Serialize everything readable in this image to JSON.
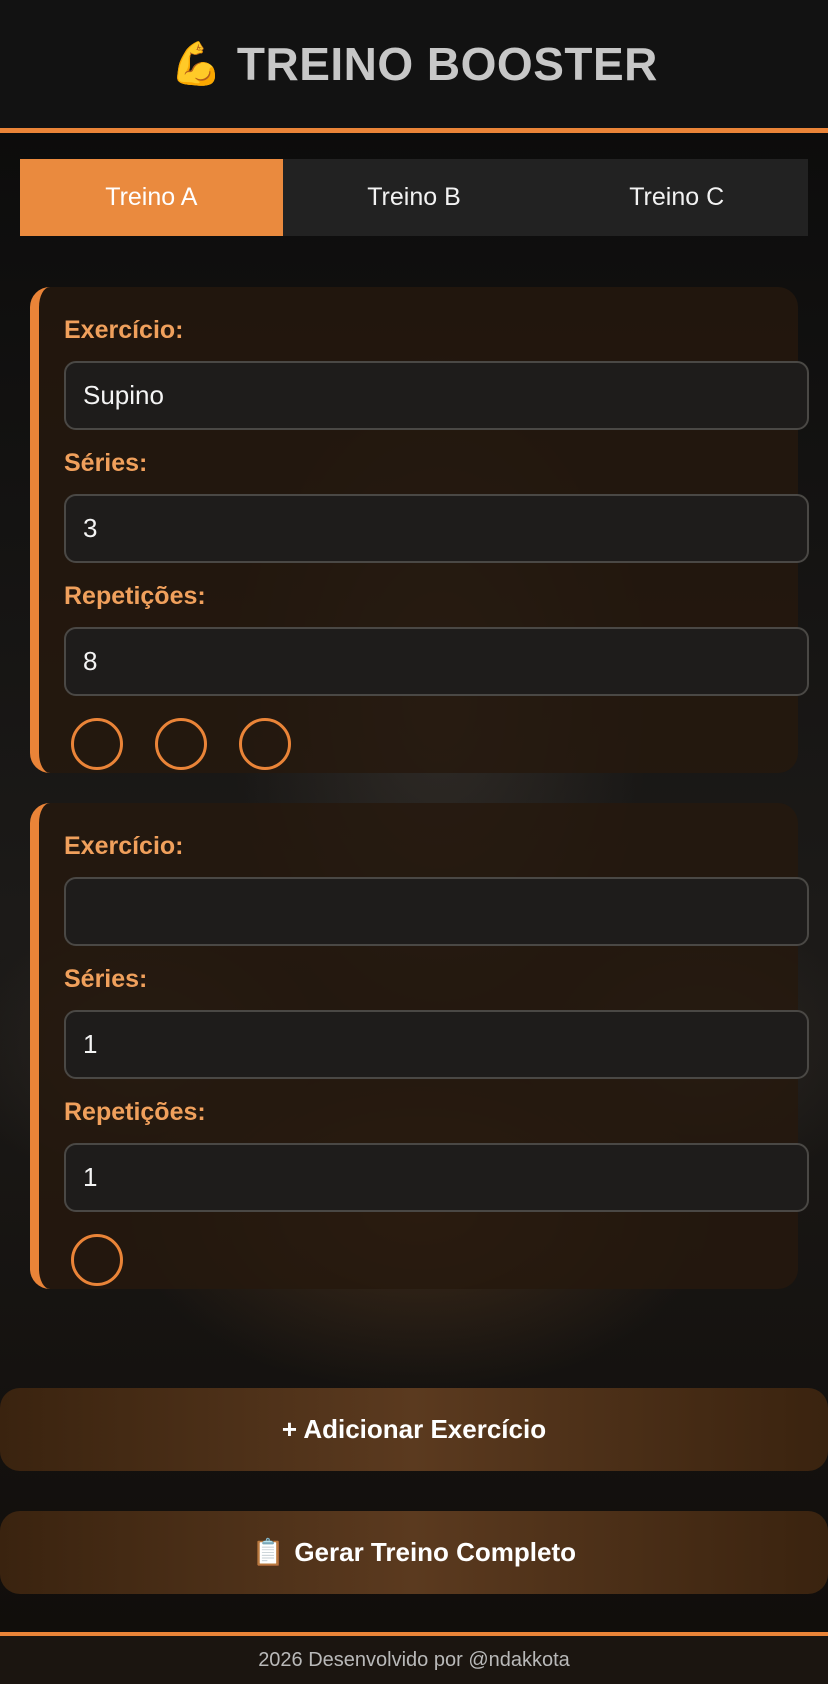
{
  "header": {
    "icon": "💪",
    "icon_name": "flexed-biceps-icon",
    "title": "TREINO BOOSTER"
  },
  "tabs": [
    {
      "label": "Treino A",
      "active": true
    },
    {
      "label": "Treino B",
      "active": false
    },
    {
      "label": "Treino C",
      "active": false
    }
  ],
  "exercises": [
    {
      "exercise_label": "Exercício:",
      "exercise_value": "Supino",
      "sets_label": "Séries:",
      "sets_value": "3",
      "reps_label": "Repetições:",
      "reps_value": "8",
      "set_circles": 3
    },
    {
      "exercise_label": "Exercício:",
      "exercise_value": "",
      "sets_label": "Séries:",
      "sets_value": "1",
      "reps_label": "Repetições:",
      "reps_value": "1",
      "set_circles": 1
    }
  ],
  "buttons": {
    "add_label": "+ Adicionar Exercício",
    "generate_icon": "📋",
    "generate_icon_name": "clipboard-icon",
    "generate_label": "Gerar Treino Completo"
  },
  "footer": {
    "text": "2026 Desenvolvido por @ndakkota"
  },
  "colors": {
    "accent": "#ea8438",
    "label": "#f0a05c",
    "header_bg": "#121212"
  }
}
